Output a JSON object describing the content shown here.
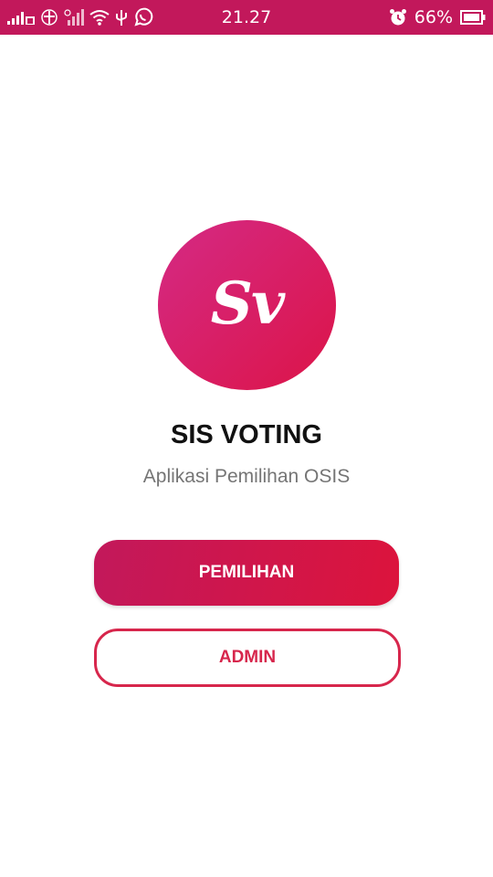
{
  "status_bar": {
    "time": "21.27",
    "battery": "66%",
    "icons": [
      "signal-icon",
      "data-icon",
      "signal-2-icon",
      "wifi-icon",
      "usb-icon",
      "whatsapp-icon",
      "alarm-icon",
      "battery-icon"
    ]
  },
  "logo": {
    "text": "Sv"
  },
  "app": {
    "title": "SIS VOTING",
    "subtitle": "Aplikasi Pemilihan OSIS"
  },
  "buttons": {
    "primary_label": "PEMILIHAN",
    "secondary_label": "ADMIN"
  },
  "colors": {
    "status_bar": "#c2185b",
    "accent": "#d7264c"
  }
}
